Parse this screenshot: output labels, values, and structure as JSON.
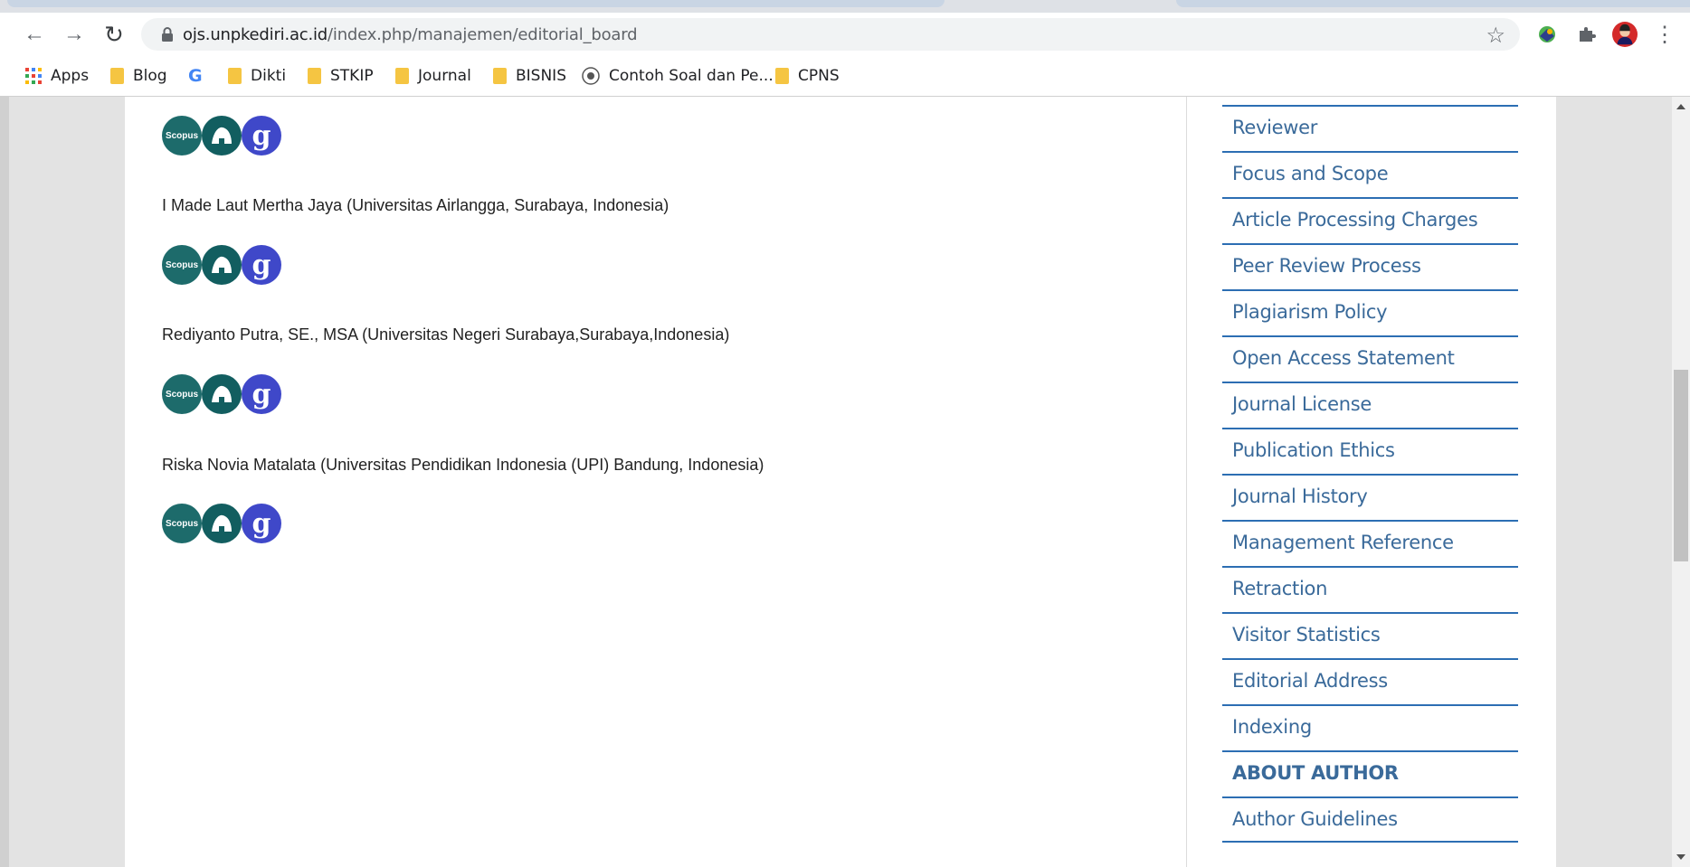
{
  "browser": {
    "url_host": "ojs.unpkediri.ac.id",
    "url_path": "/index.php/manajemen/editorial_board",
    "back_icon": "←",
    "forward_icon": "→",
    "reload_icon": "↻",
    "star_icon": "☆",
    "menu_icon": "⋮"
  },
  "bookmarks": [
    {
      "label": "Apps",
      "icon": "apps-grid"
    },
    {
      "label": "Blog",
      "icon": "folder"
    },
    {
      "label": "G",
      "icon": "google"
    },
    {
      "label": "Dikti",
      "icon": "folder"
    },
    {
      "label": "STKIP",
      "icon": "folder"
    },
    {
      "label": "Journal",
      "icon": "folder"
    },
    {
      "label": "BISNIS",
      "icon": "folder"
    },
    {
      "label": "Contoh Soal dan Pe...",
      "icon": "site-logo"
    },
    {
      "label": "CPNS",
      "icon": "folder"
    }
  ],
  "members": [
    {
      "name": "I Made Laut Mertha Jaya (Universitas Airlangga, Surabaya, Indonesia)"
    },
    {
      "name": "Rediyanto Putra, SE., MSA (Universitas Negeri Surabaya,Surabaya,Indonesia)"
    },
    {
      "name": "Riska Novia Matalata (Universitas Pendidikan Indonesia (UPI) Bandung, Indonesia)"
    }
  ],
  "badge_labels": {
    "scopus": "Scopus",
    "gs": "g"
  },
  "sidebar": {
    "items": [
      "Reviewer",
      "Focus and Scope",
      "Article Processing Charges",
      "Peer Review Process",
      "Plagiarism Policy",
      "Open Access Statement",
      "Journal License",
      "Publication Ethics",
      "Journal History",
      "Management Reference",
      "Retraction",
      "Visitor Statistics",
      "Editorial Address",
      "Indexing",
      "ABOUT AUTHOR",
      "Author Guidelines"
    ],
    "heading_index": 14
  },
  "colors": {
    "link": "#3a6a9a",
    "rule": "#2c6eb3",
    "scopus": "#1d6b6b",
    "gs": "#3f48c9"
  }
}
